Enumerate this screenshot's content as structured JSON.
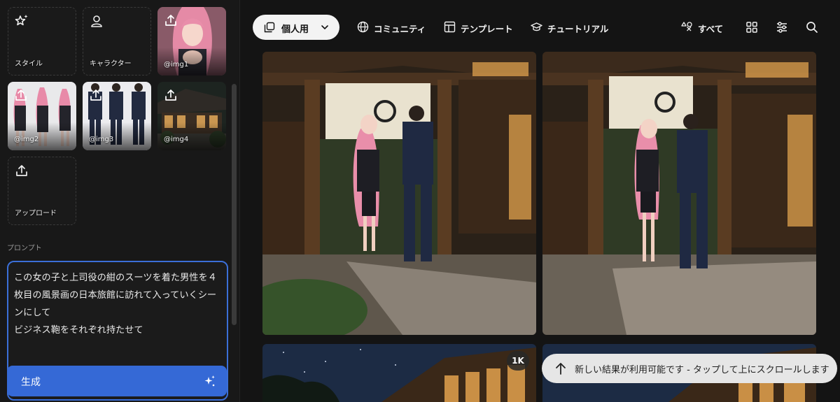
{
  "sidebar": {
    "tiles": [
      {
        "label": "スタイル",
        "icon": "star-sparkle-icon"
      },
      {
        "label": "キャラクター",
        "icon": "person-icon"
      },
      {
        "label": "@img1",
        "icon": "upload-icon"
      },
      {
        "label": "@img2",
        "icon": "upload-icon"
      },
      {
        "label": "@img3",
        "icon": "upload-icon"
      },
      {
        "label": "@img4",
        "icon": "upload-icon"
      },
      {
        "label": "アップロード",
        "icon": "upload-icon"
      }
    ],
    "prompt_label": "プロンプト",
    "prompt_text": "この女の子と上司役の紺のスーツを着た男性を４枚目の風景画の日本旅館に訪れて入っていくシーンにして\nビジネス鞄をそれぞれ持たせて",
    "generate_label": "生成"
  },
  "topbar": {
    "mode_label": "個人用",
    "nav": [
      {
        "label": "コミュニティ",
        "icon": "globe-icon"
      },
      {
        "label": "テンプレート",
        "icon": "template-icon"
      },
      {
        "label": "チュートリアル",
        "icon": "graduation-cap-icon"
      },
      {
        "label": "すべて",
        "icon": "shapes-icon"
      }
    ],
    "tool_icons": [
      "grid-view-icon",
      "filter-sliders-icon",
      "search-icon"
    ]
  },
  "gallery": {
    "badge": "1K",
    "toast": "新しい結果が利用可能です - タップして上にスクロールします"
  },
  "colors": {
    "accent": "#3569d6",
    "panel": "#181818",
    "background": "#141414"
  }
}
